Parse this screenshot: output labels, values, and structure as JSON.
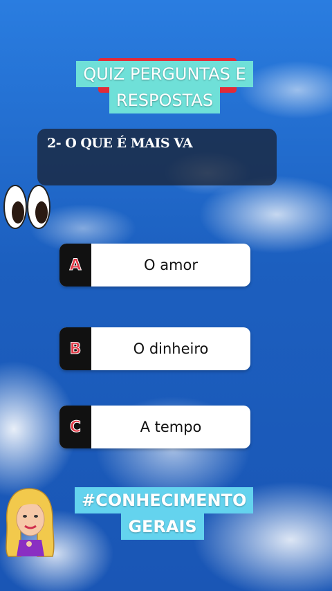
{
  "quiz": {
    "title_line1": "QUIZ PERGUNTAS E",
    "title_line2": "RESPOSTAS",
    "question": "2- O QUE É MAIS VA",
    "options": [
      {
        "letter": "A",
        "text": "O amor"
      },
      {
        "letter": "B",
        "text": "O dinheiro"
      },
      {
        "letter": "C",
        "text": "A tempo"
      }
    ],
    "hashtag_line1": "#CONHECIMENTO",
    "hashtag_line2": "GERAIS"
  },
  "icons": {
    "eyes": "eyes-emoji-icon",
    "avatar": "cartoon-woman-avatar"
  },
  "colors": {
    "title_bg": "#6fe0d8",
    "hashtag_bg": "#64d3ee",
    "letter_red": "#e33a47",
    "sky_blue": "#1c5fbf"
  }
}
